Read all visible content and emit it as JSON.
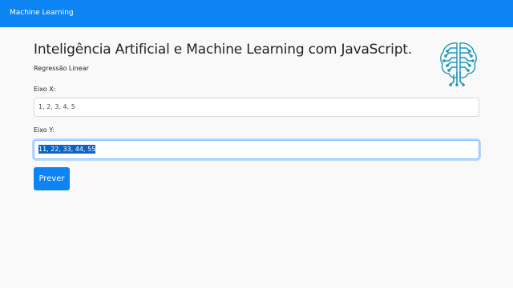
{
  "navbar": {
    "brand": "Machine Learning"
  },
  "header": {
    "title": "Inteligência Artificial e Machine Learning com JavaScript.",
    "subtitle": "Regressão Linear",
    "logo_icon": "brain-circuit-icon"
  },
  "form": {
    "x_field": {
      "label": "Eixo X:",
      "value": "1, 2, 3, 4, 5"
    },
    "y_field": {
      "label": "Eixo Y:",
      "value": "11, 22, 33, 44, 55"
    },
    "predict_label": "Prever"
  },
  "colors": {
    "primary": "#0d84f4",
    "logo": "#1c97b7",
    "selection": "#0b63c9"
  }
}
